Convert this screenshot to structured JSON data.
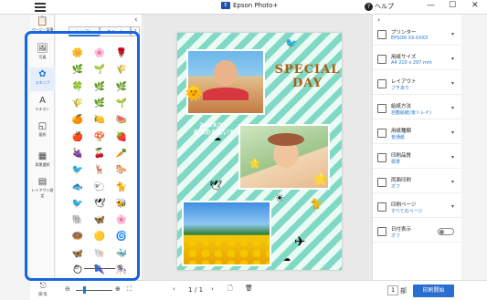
{
  "titlebar": {
    "title": "Epson Photo+",
    "help": "ヘルプ",
    "minimize": "—",
    "maximize": "☐",
    "close": "✕"
  },
  "leftbar": {
    "items": [
      {
        "label": "ページ・背景",
        "icon": "page-background-icon"
      },
      {
        "label": "写真",
        "icon": "photo-icon"
      },
      {
        "label": "スタンプ",
        "icon": "stamp-icon"
      },
      {
        "label": "テキスト",
        "icon": "text-icon"
      },
      {
        "label": "図形",
        "icon": "shape-icon"
      },
      {
        "label": "背景選択",
        "icon": "background-icon"
      },
      {
        "label": "レイアウト設定",
        "icon": "layout-icon"
      }
    ]
  },
  "stamp_panel": {
    "tabs": [
      "シンプル",
      "キュート",
      "ス"
    ],
    "active_tab": 0,
    "stamps": [
      "🌼",
      "🌸",
      "🌹",
      "🌿",
      "🌱",
      "🌾",
      "🍀",
      "🌿",
      "🌿",
      "🌾",
      "🌿",
      "🌱",
      "🍊",
      "🍋",
      "🍉",
      "🍎",
      "🍄",
      "🍓",
      "🍇",
      "🍒",
      "🥕",
      "🐦",
      "🦌",
      "🐎",
      "🐟",
      "🐑",
      "🐈",
      "🐦",
      "🕊",
      "🐝",
      "🐘",
      "🦋",
      "🌸",
      "🍩",
      "🟡",
      "🌀",
      "🦋",
      "🐚",
      "🐳",
      "🌕",
      "🌂",
      "🎠"
    ],
    "zoom_minus": "⊖",
    "zoom_plus": "⊕",
    "zoom_level": 0.4
  },
  "canvas": {
    "headline": "SPECIAL DAY",
    "date_line1": "20XX/XX",
    "date_line2": "なつのおもいで"
  },
  "bottombar": {
    "back_label": "戻る",
    "page_current": "1",
    "page_total": "/ 1",
    "copies": "1",
    "copies_unit": "部",
    "print_label": "印刷開始"
  },
  "rightpanel": {
    "items": [
      {
        "label": "プリンター",
        "value": "EPSON XX-XXXX",
        "icon": "printer-icon"
      },
      {
        "label": "用紙サイズ",
        "value": "A4 210 x 297 mm",
        "icon": "paper-size-icon"
      },
      {
        "label": "レイアウト",
        "value": "フチあり",
        "icon": "layout-icon"
      },
      {
        "label": "給紙方法",
        "value": "自動給紙(後トレイ)",
        "icon": "paper-feed-icon"
      },
      {
        "label": "用紙種類",
        "value": "普通紙",
        "icon": "paper-type-icon"
      },
      {
        "label": "印刷品質",
        "value": "標準",
        "icon": "quality-icon"
      },
      {
        "label": "両面印刷",
        "value": "オフ",
        "icon": "duplex-icon"
      },
      {
        "label": "印刷ページ",
        "value": "すべてのページ",
        "icon": "pages-icon"
      },
      {
        "label": "日付表示",
        "value": "オフ",
        "icon": "date-icon"
      }
    ]
  },
  "colors": {
    "accent": "#1e78d0",
    "highlight": "#1565e0",
    "print_button": "#2a6fd0",
    "stripe": "#7fd9c4"
  }
}
